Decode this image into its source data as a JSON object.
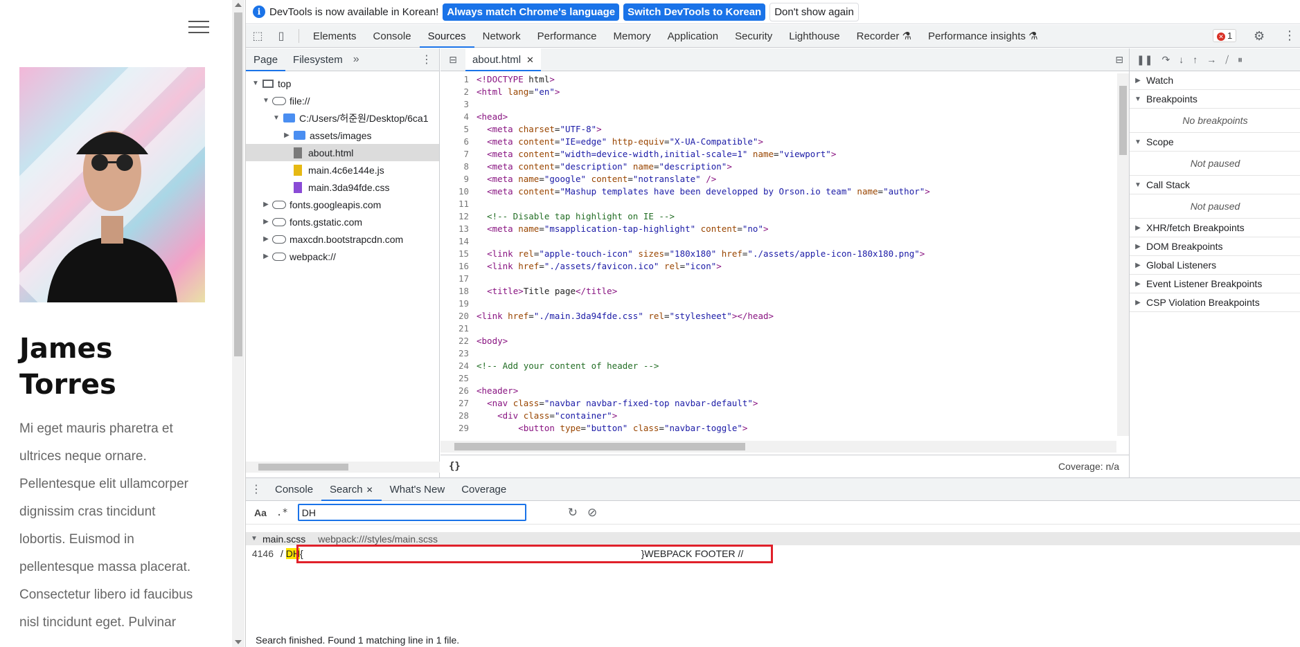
{
  "site": {
    "name_line1": "James",
    "name_line2": "Torres",
    "bio_lines": [
      "Mi eget mauris pharetra et",
      "ultrices neque ornare.",
      "Pellentesque elit ullamcorper",
      "dignissim cras tincidunt",
      "lobortis. Euismod in",
      "pellentesque massa placerat.",
      "Consectetur libero id faucibus",
      "nisl tincidunt eget. Pulvinar"
    ]
  },
  "infobar": {
    "message": "DevTools is now available in Korean!",
    "btn_match": "Always match Chrome's language",
    "btn_switch": "Switch DevTools to Korean",
    "btn_dismiss": "Don't show again"
  },
  "tabs": [
    "Elements",
    "Console",
    "Sources",
    "Network",
    "Performance",
    "Memory",
    "Application",
    "Security",
    "Lighthouse",
    "Recorder ⚗",
    "Performance insights ⚗"
  ],
  "error_count": "1",
  "navigator": {
    "tab_page": "Page",
    "tab_filesystem": "Filesystem",
    "tree": [
      {
        "label": "top",
        "indent": 0,
        "tri": "▼",
        "icon": "frame"
      },
      {
        "label": "file://",
        "indent": 1,
        "tri": "▼",
        "icon": "cloud"
      },
      {
        "label": "C:/Users/허준원/Desktop/6ca1",
        "indent": 2,
        "tri": "▼",
        "icon": "folder"
      },
      {
        "label": "assets/images",
        "indent": 3,
        "tri": "▶",
        "icon": "folder"
      },
      {
        "label": "about.html",
        "indent": 3,
        "tri": "",
        "icon": "html",
        "selected": true
      },
      {
        "label": "main.4c6e144e.js",
        "indent": 3,
        "tri": "",
        "icon": "js"
      },
      {
        "label": "main.3da94fde.css",
        "indent": 3,
        "tri": "",
        "icon": "css"
      },
      {
        "label": "fonts.googleapis.com",
        "indent": 1,
        "tri": "▶",
        "icon": "cloud"
      },
      {
        "label": "fonts.gstatic.com",
        "indent": 1,
        "tri": "▶",
        "icon": "cloud"
      },
      {
        "label": "maxcdn.bootstrapcdn.com",
        "indent": 1,
        "tri": "▶",
        "icon": "cloud"
      },
      {
        "label": "webpack://",
        "indent": 1,
        "tri": "▶",
        "icon": "cloud"
      }
    ]
  },
  "editor": {
    "file_tab": "about.html",
    "format_label": "{}",
    "coverage": "Coverage: n/a",
    "lines": [
      "<!DOCTYPE html>",
      "<html lang=\"en\">",
      "",
      "<head>",
      "  <meta charset=\"UTF-8\">",
      "  <meta content=\"IE=edge\" http-equiv=\"X-UA-Compatible\">",
      "  <meta content=\"width=device-width,initial-scale=1\" name=\"viewport\">",
      "  <meta content=\"description\" name=\"description\">",
      "  <meta name=\"google\" content=\"notranslate\" />",
      "  <meta content=\"Mashup templates have been developped by Orson.io team\" name=\"author\">",
      "",
      "  <!-- Disable tap highlight on IE -->",
      "  <meta name=\"msapplication-tap-highlight\" content=\"no\">",
      "",
      "  <link rel=\"apple-touch-icon\" sizes=\"180x180\" href=\"./assets/apple-icon-180x180.png\">",
      "  <link href=\"./assets/favicon.ico\" rel=\"icon\">",
      "",
      "  <title>Title page</title>",
      "",
      "<link href=\"./main.3da94fde.css\" rel=\"stylesheet\"></head>",
      "",
      "<body>",
      "",
      "<!-- Add your content of header -->",
      "",
      "<header>",
      "  <nav class=\"navbar navbar-fixed-top navbar-default\">",
      "    <div class=\"container\">",
      "        <button type=\"button\" class=\"navbar-toggle\">"
    ]
  },
  "debugger": {
    "panes": [
      {
        "title": "Watch",
        "open": false,
        "body": ""
      },
      {
        "title": "Breakpoints",
        "open": true,
        "body": "No breakpoints"
      },
      {
        "title": "Scope",
        "open": true,
        "body": "Not paused"
      },
      {
        "title": "Call Stack",
        "open": true,
        "body": "Not paused"
      },
      {
        "title": "XHR/fetch Breakpoints",
        "open": false,
        "body": ""
      },
      {
        "title": "DOM Breakpoints",
        "open": false,
        "body": ""
      },
      {
        "title": "Global Listeners",
        "open": false,
        "body": ""
      },
      {
        "title": "Event Listener Breakpoints",
        "open": false,
        "body": ""
      },
      {
        "title": "CSP Violation Breakpoints",
        "open": false,
        "body": ""
      }
    ]
  },
  "drawer": {
    "tabs": [
      "Console",
      "Search",
      "What's New",
      "Coverage"
    ],
    "match_case": "Aa",
    "regex": ".*",
    "search_value": "DH",
    "result_file": "main.scss",
    "result_path": "webpack:///styles/main.scss",
    "result_line_number": "4146",
    "result_prefix": "/ ",
    "result_hit": "DH",
    "result_after_hit": "{",
    "result_suffix": "}WEBPACK FOOTER //",
    "status": "Search finished.  Found 1 matching line in 1 file."
  },
  "colors": {
    "accent": "#1a73e8",
    "highlight_box": "#e0202a",
    "search_hit": "#ffe500"
  }
}
